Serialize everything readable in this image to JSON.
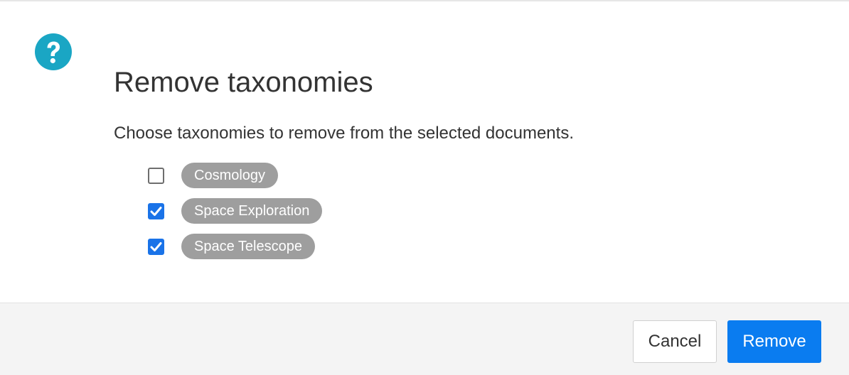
{
  "dialog": {
    "icon": "question-circle-icon",
    "icon_color": "#1aa6c4",
    "title": "Remove taxonomies",
    "description": "Choose taxonomies to remove from the selected documents."
  },
  "taxonomies": [
    {
      "label": "Cosmology",
      "checked": false
    },
    {
      "label": "Space Exploration",
      "checked": true
    },
    {
      "label": "Space Telescope",
      "checked": true
    }
  ],
  "footer": {
    "cancel_label": "Cancel",
    "remove_label": "Remove"
  },
  "colors": {
    "primary": "#0a7cf0",
    "tag_background": "#9e9e9e",
    "footer_background": "#f4f4f4"
  }
}
